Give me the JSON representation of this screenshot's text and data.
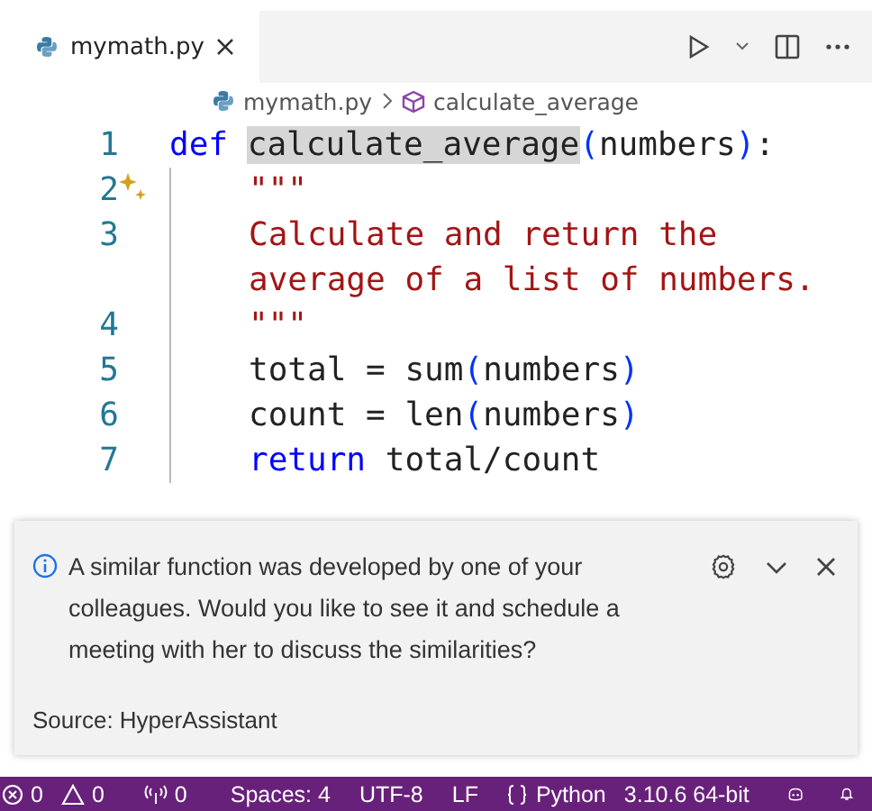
{
  "tab": {
    "label": "mymath.py",
    "selected": true
  },
  "breadcrumbs": {
    "file": "mymath.py",
    "symbol": "calculate_average"
  },
  "code_lines": [
    {
      "number": "1",
      "rows": [
        [
          {
            "text": "def ",
            "kind": "keyword"
          },
          {
            "text": "calculate_average",
            "kind": "highlight"
          },
          {
            "text": "(",
            "kind": "bracket"
          },
          {
            "text": "numbers",
            "kind": "plain"
          },
          {
            "text": ")",
            "kind": "bracket"
          },
          {
            "text": ":",
            "kind": "plain"
          }
        ]
      ]
    },
    {
      "number": "2",
      "sparkle": true,
      "rows": [
        [
          {
            "text": "\"\"\"",
            "kind": "string"
          }
        ]
      ]
    },
    {
      "number": "3",
      "rows": [
        [
          {
            "text": "Calculate and return the",
            "kind": "string"
          }
        ],
        [
          {
            "text": "average of a list of numbers.",
            "kind": "string"
          }
        ]
      ]
    },
    {
      "number": "4",
      "rows": [
        [
          {
            "text": "\"\"\"",
            "kind": "string"
          }
        ]
      ]
    },
    {
      "number": "5",
      "rows": [
        [
          {
            "text": "total = sum",
            "kind": "plain"
          },
          {
            "text": "(",
            "kind": "bracket"
          },
          {
            "text": "numbers",
            "kind": "plain"
          },
          {
            "text": ")",
            "kind": "bracket"
          }
        ]
      ]
    },
    {
      "number": "6",
      "rows": [
        [
          {
            "text": "count = len",
            "kind": "plain"
          },
          {
            "text": "(",
            "kind": "bracket"
          },
          {
            "text": "numbers",
            "kind": "plain"
          },
          {
            "text": ")",
            "kind": "bracket"
          }
        ]
      ]
    },
    {
      "number": "7",
      "rows": [
        [
          {
            "text": "return ",
            "kind": "keyword"
          },
          {
            "text": "total/count",
            "kind": "plain"
          }
        ]
      ]
    }
  ],
  "notification": {
    "message": "A similar function was developed by one of your colleagues. Would you like to see it and schedule a meeting with her to discuss the similarities?",
    "source": "Source: HyperAssistant"
  },
  "status_bar": [
    {
      "kind": "errors",
      "text": "0"
    },
    {
      "kind": "warnings",
      "text": "0"
    },
    {
      "kind": "ports",
      "text": "0"
    },
    {
      "kind": "text",
      "text": "Spaces: 4"
    },
    {
      "kind": "text",
      "text": "UTF-8"
    },
    {
      "kind": "text",
      "text": "LF"
    },
    {
      "kind": "language",
      "text": "Python"
    },
    {
      "kind": "text",
      "text": "3.10.6 64-bit"
    },
    {
      "kind": "copilot"
    },
    {
      "kind": "bell"
    }
  ]
}
